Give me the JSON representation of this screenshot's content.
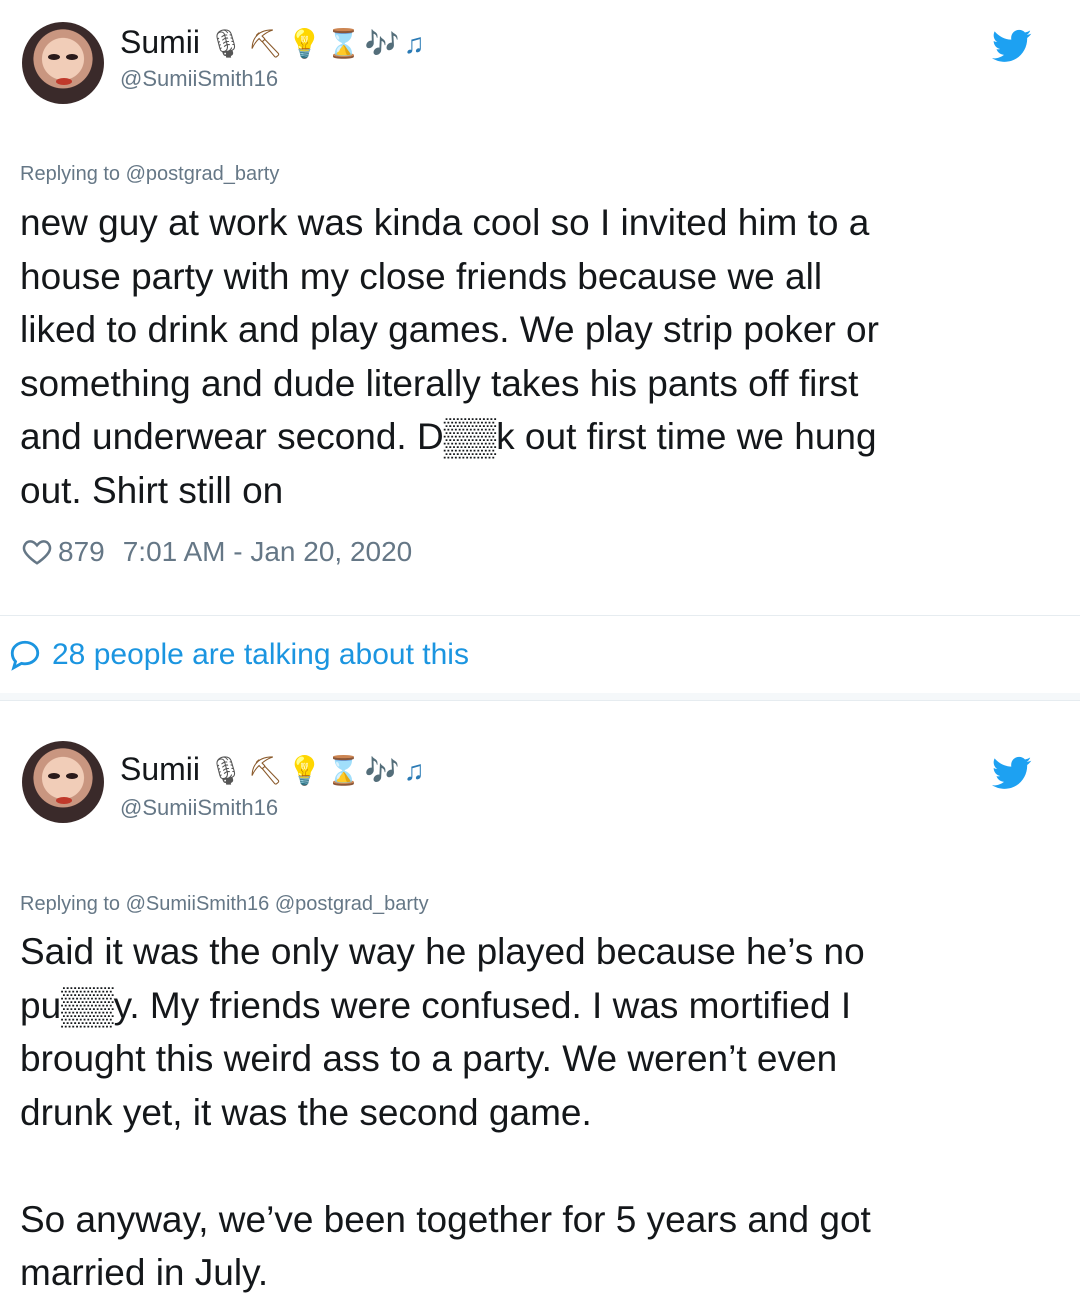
{
  "tweets": [
    {
      "name": "Sumii",
      "emojis": {
        "mic": "🎙",
        "hammer": "⛏",
        "bulb": "💡",
        "hourglass": "⌛",
        "notes": "🎶♫"
      },
      "handle": "@SumiiSmith16",
      "replying_prefix": "Replying to ",
      "replying_to": "@postgrad_barty",
      "text": "new guy at work was kinda cool so I invited him to a\nhouse party with my close friends because we all\nliked to drink and play games. We play strip poker or\nsomething and dude literally takes his pants off first\nand underwear second. D▒▒k out first time we hung\nout. Shirt still on",
      "likes": "879",
      "timestamp": "7:01 AM - Jan 20, 2020"
    },
    {
      "name": "Sumii",
      "emojis": {
        "mic": "🎙",
        "hammer": "⛏",
        "bulb": "💡",
        "hourglass": "⌛",
        "notes": "🎶♫"
      },
      "handle": "@SumiiSmith16",
      "replying_prefix": "Replying to ",
      "replying_to": "@SumiiSmith16 @postgrad_barty",
      "text": "Said it was the only way he played because he’s no\npu▒▒y. My friends were confused. I was mortified I\nbrought this weird ass to a party. We weren’t even\ndrunk yet, it was the second game.\n\nSo anyway, we’ve been together for 5 years and got\nmarried in July."
    }
  ],
  "conversation": {
    "label": "28 people are talking about this"
  },
  "colors": {
    "twitter_blue": "#1b95e0",
    "secondary_text": "#657786",
    "primary_text": "#14171a"
  },
  "icons": {
    "bird": "twitter-bird-icon",
    "heart": "heart-icon",
    "reply": "speech-bubble-icon"
  }
}
